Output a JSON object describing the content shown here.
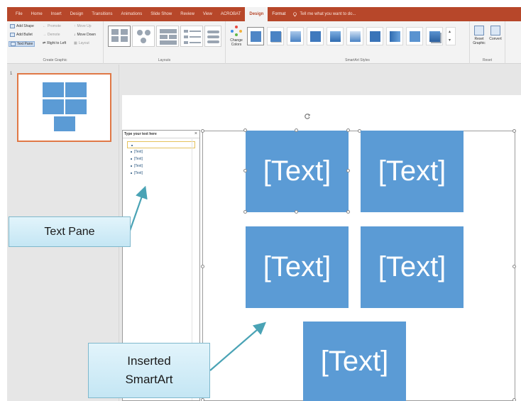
{
  "ribbon": {
    "tabs": [
      "File",
      "Home",
      "Insert",
      "Design",
      "Transitions",
      "Animations",
      "Slide Show",
      "Review",
      "View",
      "ACROBAT",
      "Design",
      "Format"
    ],
    "active_tab_index": 10,
    "tell_me": "Tell me what you want to do...",
    "create_graphic": {
      "add_shape": "Add Shape",
      "add_bullet": "Add Bullet",
      "text_pane": "Text Pane",
      "promote": "Promote",
      "demote": "Demote",
      "right_to_left": "Right to Left",
      "move_up": "Move Up",
      "move_down": "Move Down",
      "layout": "Layout",
      "label": "Create Graphic"
    },
    "layouts_label": "Layouts",
    "change_colors": "Change Colors",
    "styles_label": "SmartArt Styles",
    "reset": {
      "reset_graphic": "Reset Graphic",
      "convert": "Convert",
      "label": "Reset"
    }
  },
  "thumbnails": {
    "slide_number": "1"
  },
  "text_pane": {
    "title": "Type your text here",
    "close": "×",
    "items": [
      "",
      "[Text]",
      "[Text]",
      "[Text]",
      "[Text]"
    ]
  },
  "smartart": {
    "boxes": [
      "[Text]",
      "[Text]",
      "[Text]",
      "[Text]",
      "[Text]"
    ],
    "fill_color": "#5b9bd5"
  },
  "callouts": {
    "text_pane": "Text Pane",
    "inserted_line1": "Inserted",
    "inserted_line2": "SmartArt"
  },
  "colors": {
    "ribbon_tab_bar": "#b7472a",
    "selection_outline": "#e07846",
    "callout_arrow": "#4aa3b5"
  }
}
